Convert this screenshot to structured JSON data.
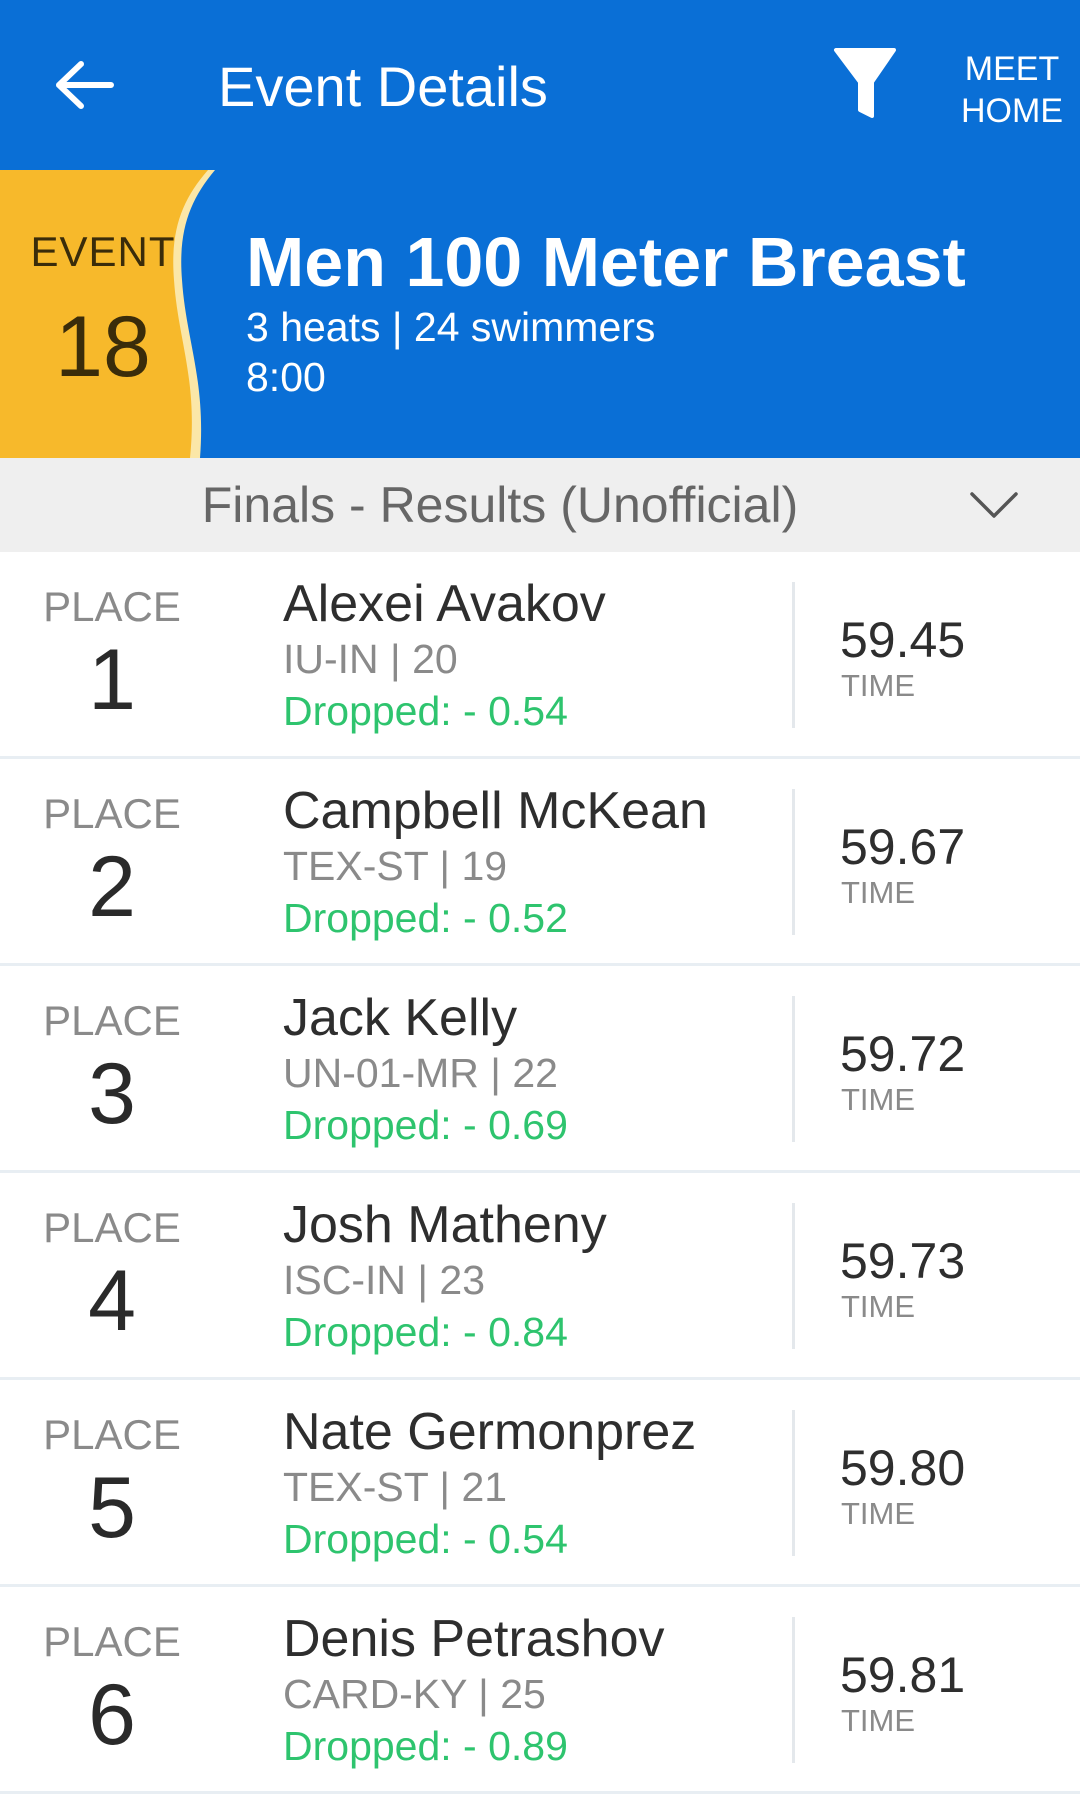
{
  "header": {
    "title": "Event Details",
    "meet_home_line1": "MEET",
    "meet_home_line2": "HOME"
  },
  "event": {
    "label": "EVENT",
    "number": "18",
    "name": "Men 100 Meter Breast",
    "summary": "3 heats | 24 swimmers",
    "time": "8:00"
  },
  "section": {
    "label": "Finals - Results (Unofficial)"
  },
  "results": [
    {
      "place_label": "PLACE",
      "place": "1",
      "name": "Alexei Avakov",
      "team_age": "IU-IN | 20",
      "dropped": "Dropped: - 0.54",
      "time": "59.45",
      "time_label": "TIME"
    },
    {
      "place_label": "PLACE",
      "place": "2",
      "name": "Campbell McKean",
      "team_age": "TEX-ST | 19",
      "dropped": "Dropped: - 0.52",
      "time": "59.67",
      "time_label": "TIME"
    },
    {
      "place_label": "PLACE",
      "place": "3",
      "name": "Jack Kelly",
      "team_age": "UN-01-MR | 22",
      "dropped": "Dropped: - 0.69",
      "time": "59.72",
      "time_label": "TIME"
    },
    {
      "place_label": "PLACE",
      "place": "4",
      "name": "Josh Matheny",
      "team_age": "ISC-IN | 23",
      "dropped": "Dropped: - 0.84",
      "time": "59.73",
      "time_label": "TIME"
    },
    {
      "place_label": "PLACE",
      "place": "5",
      "name": "Nate Germonprez",
      "team_age": "TEX-ST | 21",
      "dropped": "Dropped: - 0.54",
      "time": "59.80",
      "time_label": "TIME"
    },
    {
      "place_label": "PLACE",
      "place": "6",
      "name": "Denis Petrashov",
      "team_age": "CARD-KY | 25",
      "dropped": "Dropped: - 0.89",
      "time": "59.81",
      "time_label": "TIME"
    }
  ],
  "colors": {
    "header_blue": "#0a6fd6",
    "event_tab_yellow": "#f7b92b",
    "dropped_green": "#2ec46e"
  },
  "icons": {
    "back": "arrow-left-icon",
    "filter": "funnel-icon",
    "chevron": "chevron-down-icon"
  }
}
